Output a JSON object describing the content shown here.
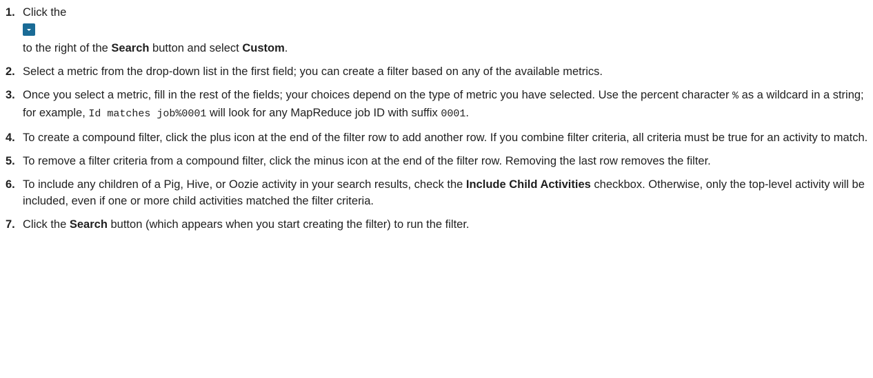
{
  "steps": [
    {
      "num": "1.",
      "text_before_icon": "Click the",
      "icon": "caret-down-icon",
      "text_a": "to the right of the ",
      "bold_a": "Search",
      "text_b": " button and select ",
      "bold_b": "Custom",
      "text_c": "."
    },
    {
      "num": "2.",
      "text": "Select a metric from the drop-down list in the first field; you can create a filter based on any of the available metrics."
    },
    {
      "num": "3.",
      "text_a": "Once you select a metric, fill in the rest of the fields; your choices depend on the type of metric you have selected. Use the percent character ",
      "code_a": "%",
      "text_b": " as a wildcard in a string; for example, ",
      "code_b": "Id matches job%0001",
      "text_c": " will look for any MapReduce job ID with suffix ",
      "code_c": "0001",
      "text_d": "."
    },
    {
      "num": "4.",
      "text": "To create a compound filter, click the plus icon at the end of the filter row to add another row. If you combine filter criteria, all criteria must be true for an activity to match."
    },
    {
      "num": "5.",
      "text": "To remove a filter criteria from a compound filter, click the minus icon at the end of the filter row. Removing the last row removes the filter."
    },
    {
      "num": "6.",
      "text_a": "To include any children of a Pig, Hive, or Oozie activity in your search results, check the ",
      "bold_a": "Include Child Activities",
      "text_b": " checkbox. Otherwise, only the top-level activity will be included, even if one or more child activities matched the filter criteria."
    },
    {
      "num": "7.",
      "text_a": "Click the ",
      "bold_a": "Search",
      "text_b": " button (which appears when you start creating the filter) to run the filter."
    }
  ],
  "colors": {
    "icon_button": "#1a6b96",
    "text": "#1f1f1f"
  }
}
